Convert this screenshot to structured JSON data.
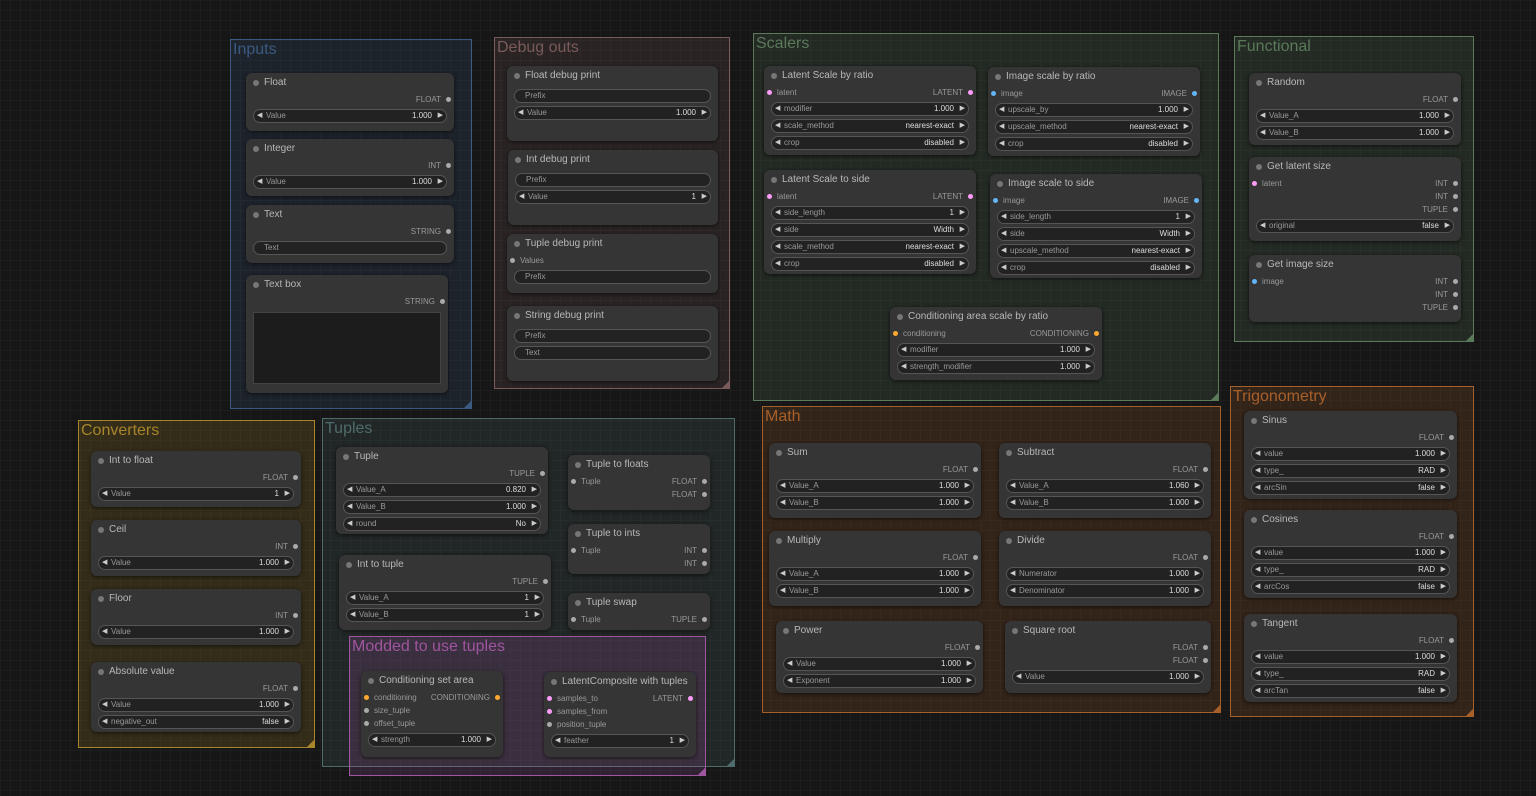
{
  "colors": {
    "inputs": "#3b5a82",
    "debug": "#7a5a5a",
    "scalers": "#5a7a5a",
    "functional": "#5a7a5a",
    "converters": "#a8852a",
    "tuples": "#4f6b6b",
    "modded": "#a055a0",
    "math": "#a8602a",
    "trig": "#a8602a",
    "FLOAT": "#aaa",
    "INT": "#aaa",
    "LATENT": "#ff9cf9",
    "IMAGE": "#64b5f6",
    "STRING": "#aaa",
    "CONDITIONING": "#ffa931",
    "TUPLE": "#aaa"
  },
  "groups": [
    {
      "id": "inputs",
      "title": "Inputs"
    },
    {
      "id": "debug",
      "title": "Debug outs"
    },
    {
      "id": "scalers",
      "title": "Scalers"
    },
    {
      "id": "functional",
      "title": "Functional"
    },
    {
      "id": "converters",
      "title": "Converters"
    },
    {
      "id": "tuples",
      "title": "Tuples"
    },
    {
      "id": "modded",
      "title": "Modded to use tuples"
    },
    {
      "id": "math",
      "title": "Math"
    },
    {
      "id": "trig",
      "title": "Trigonometry"
    }
  ],
  "nodes": [
    {
      "id": "float",
      "title": "Float",
      "outputs": [
        {
          "label": "FLOAT",
          "type": "FLOAT"
        }
      ],
      "widgets": [
        {
          "label": "Value",
          "value": "1.000"
        }
      ]
    },
    {
      "id": "integer",
      "title": "Integer",
      "outputs": [
        {
          "label": "INT",
          "type": "INT"
        }
      ],
      "widgets": [
        {
          "label": "Value",
          "value": "1.000"
        }
      ]
    },
    {
      "id": "text",
      "title": "Text",
      "outputs": [
        {
          "label": "STRING",
          "type": "STRING"
        }
      ],
      "texts": [
        "Text"
      ]
    },
    {
      "id": "textbox",
      "title": "Text box",
      "outputs": [
        {
          "label": "STRING",
          "type": "STRING"
        }
      ],
      "textarea": true
    },
    {
      "id": "floatdbg",
      "title": "Float debug print",
      "texts": [
        "Prefix"
      ],
      "widgets": [
        {
          "label": "Value",
          "value": "1.000"
        }
      ]
    },
    {
      "id": "intdbg",
      "title": "Int debug print",
      "texts": [
        "Prefix"
      ],
      "widgets": [
        {
          "label": "Value",
          "value": "1"
        }
      ]
    },
    {
      "id": "tupledbg",
      "title": "Tuple debug print",
      "inputs": [
        {
          "label": "Values",
          "type": "TUPLE"
        }
      ],
      "texts": [
        "Prefix"
      ]
    },
    {
      "id": "strdbg",
      "title": "String debug print",
      "texts": [
        "Prefix",
        "Text"
      ]
    },
    {
      "id": "latentratio",
      "title": "Latent Scale by ratio",
      "io": [
        {
          "in": "latent",
          "out": "LATENT",
          "type": "LATENT"
        }
      ],
      "widgets": [
        {
          "label": "modifier",
          "value": "1.000"
        },
        {
          "label": "scale_method",
          "value": "nearest-exact"
        },
        {
          "label": "crop",
          "value": "disabled"
        }
      ]
    },
    {
      "id": "imageratio",
      "title": "Image scale by ratio",
      "io": [
        {
          "in": "image",
          "out": "IMAGE",
          "type": "IMAGE"
        }
      ],
      "widgets": [
        {
          "label": "upscale_by",
          "value": "1.000"
        },
        {
          "label": "upscale_method",
          "value": "nearest-exact"
        },
        {
          "label": "crop",
          "value": "disabled"
        }
      ]
    },
    {
      "id": "latentside",
      "title": "Latent Scale to side",
      "io": [
        {
          "in": "latent",
          "out": "LATENT",
          "type": "LATENT"
        }
      ],
      "widgets": [
        {
          "label": "side_length",
          "value": "1"
        },
        {
          "label": "side",
          "value": "Width"
        },
        {
          "label": "scale_method",
          "value": "nearest-exact"
        },
        {
          "label": "crop",
          "value": "disabled"
        }
      ]
    },
    {
      "id": "imageside",
      "title": "Image scale to side",
      "io": [
        {
          "in": "image",
          "out": "IMAGE",
          "type": "IMAGE"
        }
      ],
      "widgets": [
        {
          "label": "side_length",
          "value": "1"
        },
        {
          "label": "side",
          "value": "Width"
        },
        {
          "label": "upscale_method",
          "value": "nearest-exact"
        },
        {
          "label": "crop",
          "value": "disabled"
        }
      ]
    },
    {
      "id": "condratio",
      "title": "Conditioning area scale by ratio",
      "io": [
        {
          "in": "conditioning",
          "out": "CONDITIONING",
          "type": "CONDITIONING"
        }
      ],
      "widgets": [
        {
          "label": "modifier",
          "value": "1.000"
        },
        {
          "label": "strength_modifier",
          "value": "1.000"
        }
      ]
    },
    {
      "id": "random",
      "title": "Random",
      "outputs": [
        {
          "label": "FLOAT",
          "type": "FLOAT"
        }
      ],
      "widgets": [
        {
          "label": "Value_A",
          "value": "1.000"
        },
        {
          "label": "Value_B",
          "value": "1.000"
        }
      ]
    },
    {
      "id": "latentsize",
      "title": "Get latent size",
      "io": [
        {
          "in": "latent",
          "out": "INT",
          "type": "LATENT"
        }
      ],
      "outputs": [
        {
          "label": "INT",
          "type": "INT"
        },
        {
          "label": "TUPLE",
          "type": "TUPLE"
        }
      ],
      "widgets": [
        {
          "label": "original",
          "value": "false"
        }
      ]
    },
    {
      "id": "imagesize",
      "title": "Get image size",
      "io": [
        {
          "in": "image",
          "out": "INT",
          "type": "IMAGE"
        }
      ],
      "outputs": [
        {
          "label": "INT",
          "type": "INT"
        },
        {
          "label": "TUPLE",
          "type": "TUPLE"
        }
      ]
    },
    {
      "id": "inttofloat",
      "title": "Int to float",
      "outputs": [
        {
          "label": "FLOAT",
          "type": "FLOAT"
        }
      ],
      "widgets": [
        {
          "label": "Value",
          "value": "1"
        }
      ]
    },
    {
      "id": "ceil",
      "title": "Ceil",
      "outputs": [
        {
          "label": "INT",
          "type": "INT"
        }
      ],
      "widgets": [
        {
          "label": "Value",
          "value": "1.000"
        }
      ]
    },
    {
      "id": "floor",
      "title": "Floor",
      "outputs": [
        {
          "label": "INT",
          "type": "INT"
        }
      ],
      "widgets": [
        {
          "label": "Value",
          "value": "1.000"
        }
      ]
    },
    {
      "id": "absval",
      "title": "Absolute value",
      "outputs": [
        {
          "label": "FLOAT",
          "type": "FLOAT"
        }
      ],
      "widgets": [
        {
          "label": "Value",
          "value": "1.000"
        },
        {
          "label": "negative_out",
          "value": "false"
        }
      ]
    },
    {
      "id": "tuple",
      "title": "Tuple",
      "outputs": [
        {
          "label": "TUPLE",
          "type": "TUPLE"
        }
      ],
      "widgets": [
        {
          "label": "Value_A",
          "value": "0.820"
        },
        {
          "label": "Value_B",
          "value": "1.000"
        },
        {
          "label": "round",
          "value": "No"
        }
      ]
    },
    {
      "id": "inttotuple",
      "title": "Int to tuple",
      "outputs": [
        {
          "label": "TUPLE",
          "type": "TUPLE"
        }
      ],
      "widgets": [
        {
          "label": "Value_A",
          "value": "1"
        },
        {
          "label": "Value_B",
          "value": "1"
        }
      ]
    },
    {
      "id": "tupletofloats",
      "title": "Tuple to floats",
      "io": [
        {
          "in": "Tuple",
          "out": "FLOAT",
          "type": "TUPLE"
        }
      ],
      "outputs": [
        {
          "label": "FLOAT",
          "type": "FLOAT"
        }
      ]
    },
    {
      "id": "tupletoints",
      "title": "Tuple to ints",
      "io": [
        {
          "in": "Tuple",
          "out": "INT",
          "type": "TUPLE"
        }
      ],
      "outputs": [
        {
          "label": "INT",
          "type": "INT"
        }
      ]
    },
    {
      "id": "tupleswap",
      "title": "Tuple swap",
      "io": [
        {
          "in": "Tuple",
          "out": "TUPLE",
          "type": "TUPLE"
        }
      ]
    },
    {
      "id": "condsetarea",
      "title": "Conditioning set area",
      "io": [
        {
          "in": "conditioning",
          "out": "CONDITIONING",
          "type": "CONDITIONING"
        }
      ],
      "inputs": [
        {
          "label": "size_tuple",
          "type": "TUPLE"
        },
        {
          "label": "offset_tuple",
          "type": "TUPLE"
        }
      ],
      "widgets": [
        {
          "label": "strength",
          "value": "1.000"
        }
      ]
    },
    {
      "id": "latentcomp",
      "title": "LatentComposite with tuples",
      "io": [
        {
          "in": "samples_to",
          "out": "LATENT",
          "type": "LATENT"
        }
      ],
      "inputs": [
        {
          "label": "samples_from",
          "type": "LATENT"
        },
        {
          "label": "position_tuple",
          "type": "TUPLE"
        }
      ],
      "widgets": [
        {
          "label": "feather",
          "value": "1"
        }
      ]
    },
    {
      "id": "sum",
      "title": "Sum",
      "outputs": [
        {
          "label": "FLOAT",
          "type": "FLOAT"
        }
      ],
      "widgets": [
        {
          "label": "Value_A",
          "value": "1.000"
        },
        {
          "label": "Value_B",
          "value": "1.000"
        }
      ]
    },
    {
      "id": "subtract",
      "title": "Subtract",
      "outputs": [
        {
          "label": "FLOAT",
          "type": "FLOAT"
        }
      ],
      "widgets": [
        {
          "label": "Value_A",
          "value": "1.060"
        },
        {
          "label": "Value_B",
          "value": "1.000"
        }
      ]
    },
    {
      "id": "multiply",
      "title": "Multiply",
      "outputs": [
        {
          "label": "FLOAT",
          "type": "FLOAT"
        }
      ],
      "widgets": [
        {
          "label": "Value_A",
          "value": "1.000"
        },
        {
          "label": "Value_B",
          "value": "1.000"
        }
      ]
    },
    {
      "id": "divide",
      "title": "Divide",
      "outputs": [
        {
          "label": "FLOAT",
          "type": "FLOAT"
        }
      ],
      "widgets": [
        {
          "label": "Numerator",
          "value": "1.000"
        },
        {
          "label": "Denominator",
          "value": "1.000"
        }
      ]
    },
    {
      "id": "power",
      "title": "Power",
      "outputs": [
        {
          "label": "FLOAT",
          "type": "FLOAT"
        }
      ],
      "widgets": [
        {
          "label": "Value",
          "value": "1.000"
        },
        {
          "label": "Exponent",
          "value": "1.000"
        }
      ]
    },
    {
      "id": "sqrt",
      "title": "Square root",
      "outputs": [
        {
          "label": "FLOAT",
          "type": "FLOAT"
        },
        {
          "label": "FLOAT",
          "type": "FLOAT"
        }
      ],
      "widgets": [
        {
          "label": "Value",
          "value": "1.000"
        }
      ]
    },
    {
      "id": "sinus",
      "title": "Sinus",
      "outputs": [
        {
          "label": "FLOAT",
          "type": "FLOAT"
        }
      ],
      "widgets": [
        {
          "label": "value",
          "value": "1.000"
        },
        {
          "label": "type_",
          "value": "RAD"
        },
        {
          "label": "arcSin",
          "value": "false"
        }
      ]
    },
    {
      "id": "cosines",
      "title": "Cosines",
      "outputs": [
        {
          "label": "FLOAT",
          "type": "FLOAT"
        }
      ],
      "widgets": [
        {
          "label": "value",
          "value": "1.000"
        },
        {
          "label": "type_",
          "value": "RAD"
        },
        {
          "label": "arcCos",
          "value": "false"
        }
      ]
    },
    {
      "id": "tangent",
      "title": "Tangent",
      "outputs": [
        {
          "label": "FLOAT",
          "type": "FLOAT"
        }
      ],
      "widgets": [
        {
          "label": "value",
          "value": "1.000"
        },
        {
          "label": "type_",
          "value": "RAD"
        },
        {
          "label": "arcTan",
          "value": "false"
        }
      ]
    }
  ]
}
